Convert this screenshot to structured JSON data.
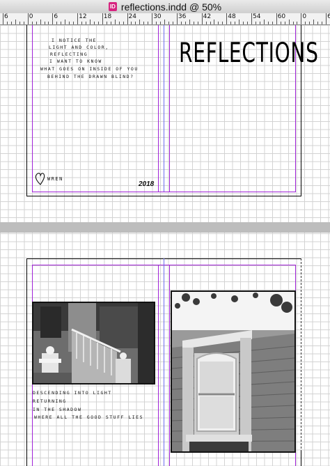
{
  "window": {
    "title": "reflections.indd @ 50%",
    "app_icon": "indesign-document-icon",
    "app_icon_label": "ID"
  },
  "ruler": {
    "labels": [
      "6",
      "0",
      "6",
      "12",
      "18",
      "24",
      "30",
      "36",
      "42",
      "48",
      "54",
      "60",
      "0",
      "6"
    ]
  },
  "spread1": {
    "poem_lines": [
      "I NOTICE THE",
      "LIGHT AND COLOR,",
      "REFLECTING",
      "I WANT TO KNOW",
      "WHAT GOES ON INSIDE OF YOU",
      "BEHIND THE DRAWN BLIND?"
    ],
    "title": "REFLECTIONS",
    "year": "2018",
    "signature": "WREN"
  },
  "spread2": {
    "caption_lines": [
      "DESCENDING INTO LIGHT",
      "RETURNING",
      "IN THE SHADOW",
      "WHERE ALL THE GOOD STUFF LIES"
    ],
    "photo_left": "porch-stairs-photo",
    "photo_right": "victorian-window-photo"
  }
}
